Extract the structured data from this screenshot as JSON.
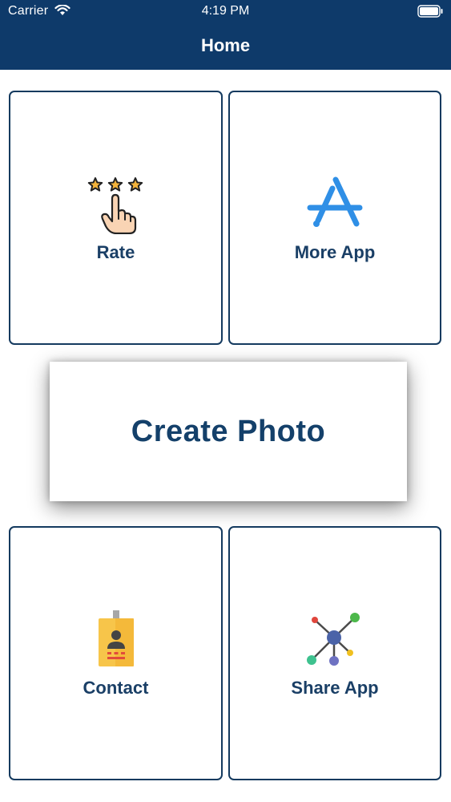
{
  "status_bar": {
    "carrier": "Carrier",
    "time": "4:19 PM",
    "icons": [
      "wifi-icon",
      "battery-icon"
    ]
  },
  "header": {
    "title": "Home",
    "background_color": "#0e3a6a"
  },
  "tiles": [
    {
      "label": "Rate",
      "icon": "rate-stars-hand-icon"
    },
    {
      "label": "More App",
      "icon": "app-store-icon"
    },
    {
      "label": "Contact",
      "icon": "contact-badge-icon"
    },
    {
      "label": "Share App",
      "icon": "share-network-icon"
    }
  ],
  "create_button": {
    "label": "Create Photo"
  },
  "colors": {
    "accent": "#143a5f",
    "text": "#1a3f66"
  }
}
